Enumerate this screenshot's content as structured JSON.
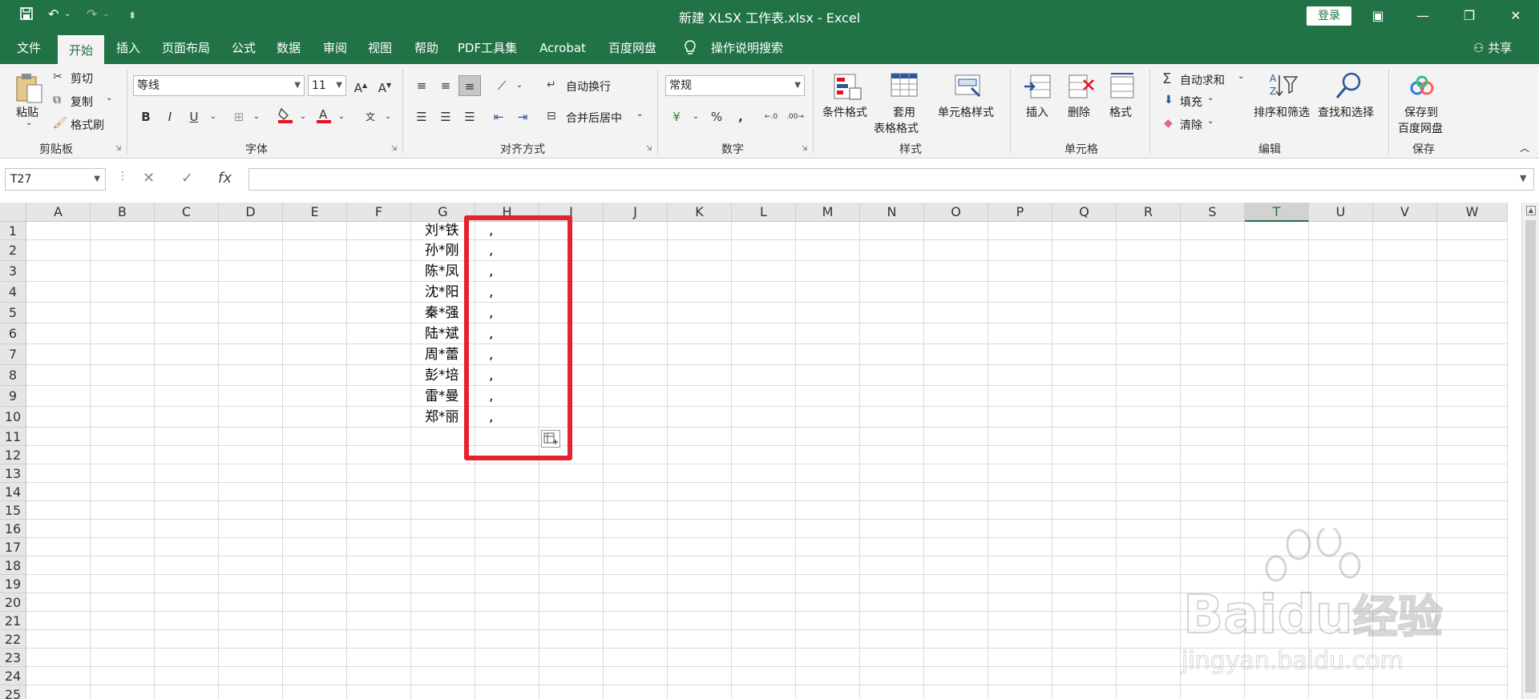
{
  "window": {
    "title": "新建 XLSX 工作表.xlsx  -  Excel",
    "login_label": "登录",
    "share_label": "共享"
  },
  "tabs": [
    {
      "label": "文件",
      "active": false
    },
    {
      "label": "开始",
      "active": true
    },
    {
      "label": "插入",
      "active": false
    },
    {
      "label": "页面布局",
      "active": false
    },
    {
      "label": "公式",
      "active": false
    },
    {
      "label": "数据",
      "active": false
    },
    {
      "label": "审阅",
      "active": false
    },
    {
      "label": "视图",
      "active": false
    },
    {
      "label": "帮助",
      "active": false
    },
    {
      "label": "PDF工具集",
      "active": false
    },
    {
      "label": "Acrobat",
      "active": false
    },
    {
      "label": "百度网盘",
      "active": false
    }
  ],
  "tell_me": "操作说明搜索",
  "ribbon": {
    "clipboard": {
      "label": "剪贴板",
      "paste": "粘贴",
      "cut": "剪切",
      "copy": "复制",
      "format_painter": "格式刷"
    },
    "font": {
      "label": "字体",
      "font_name": "等线",
      "font_size": "11",
      "bold": "B",
      "italic": "I",
      "underline": "U"
    },
    "alignment": {
      "label": "对齐方式",
      "wrap_text": "自动换行",
      "merge_center": "合并后居中"
    },
    "number": {
      "label": "数字",
      "format": "常规",
      "percent": "%",
      "comma": ","
    },
    "styles": {
      "label": "样式",
      "conditional": "条件格式",
      "table_line1": "套用",
      "table_line2": "表格格式",
      "cell_styles": "单元格样式"
    },
    "cells": {
      "label": "单元格",
      "insert": "插入",
      "delete": "删除",
      "format": "格式"
    },
    "editing": {
      "label": "编辑",
      "autosum": "自动求和",
      "fill": "填充",
      "clear": "清除",
      "sort_filter": "排序和筛选",
      "find_select": "查找和选择"
    },
    "save": {
      "label": "保存",
      "save_line1": "保存到",
      "save_line2": "百度网盘"
    }
  },
  "formula_bar": {
    "name_box": "T27",
    "fx": "fx",
    "content": ""
  },
  "sheet": {
    "columns": [
      "A",
      "B",
      "C",
      "D",
      "E",
      "F",
      "G",
      "H",
      "I",
      "J",
      "K",
      "L",
      "M",
      "N",
      "O",
      "P",
      "Q",
      "R",
      "S",
      "T",
      "U",
      "V",
      "W"
    ],
    "selected_column": "T",
    "rows": [
      "1",
      "2",
      "3",
      "4",
      "5",
      "6",
      "7",
      "8",
      "9",
      "10",
      "11",
      "12",
      "13",
      "14",
      "15",
      "16",
      "17",
      "18",
      "19",
      "20",
      "21",
      "22",
      "23",
      "24",
      "25"
    ],
    "col_g": [
      "刘*铁",
      "孙*刚",
      "陈*凤",
      "沈*阳",
      "秦*强",
      "陆*斌",
      "周*蕾",
      "彭*培",
      "雷*曼",
      "郑*丽"
    ],
    "col_h": [
      ",",
      ",",
      ",",
      ",",
      ",",
      ",",
      ",",
      ",",
      ",",
      ","
    ]
  },
  "watermark": {
    "brand": "Bai",
    "brand2": "du",
    "cn": "经验",
    "url": "jingyan.baidu.com"
  },
  "colors": {
    "accent": "#217346",
    "highlight": "#e5232c"
  }
}
